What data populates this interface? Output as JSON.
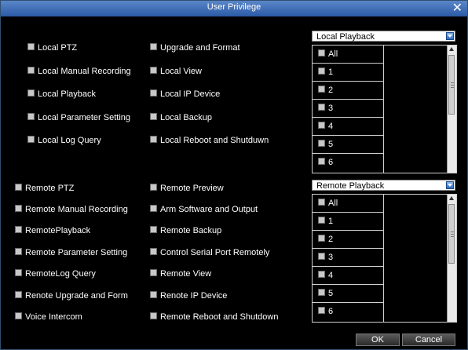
{
  "window": {
    "title": "User Privilege"
  },
  "local": {
    "col1": [
      "Local PTZ",
      "Local Manual Recording",
      "Local Playback",
      "Local Parameter Setting",
      "Local Log Query"
    ],
    "col2": [
      "Upgrade and Format",
      "Local View",
      "Local IP Device",
      "Local Backup",
      "Local Reboot and Shutduwn"
    ],
    "dropdown": "Local Playback",
    "channels": [
      "All",
      "1",
      "2",
      "3",
      "4",
      "5",
      "6"
    ]
  },
  "remote": {
    "col1": [
      "Remote PTZ",
      "Remote Manual Recording",
      "RemotePlayback",
      "Remote Parameter Setting",
      "RemoteLog Query",
      "Renote Upgrade and Form",
      "Voice Intercom"
    ],
    "col2": [
      "Remote Preview",
      "Arm Software and Output",
      "Remote Backup",
      "Control Serial Port Remotely",
      "Remote View",
      "Renote IP Device",
      "Remote Reboot and Shutdown"
    ],
    "dropdown": "Remote Playback",
    "channels": [
      "All",
      "1",
      "2",
      "3",
      "4",
      "5",
      "6"
    ]
  },
  "buttons": {
    "ok": "OK",
    "cancel": "Cancel"
  },
  "icons": {
    "close": "close-icon",
    "checkbox": "checkbox-icon",
    "dropdown": "chevron-down-icon"
  }
}
